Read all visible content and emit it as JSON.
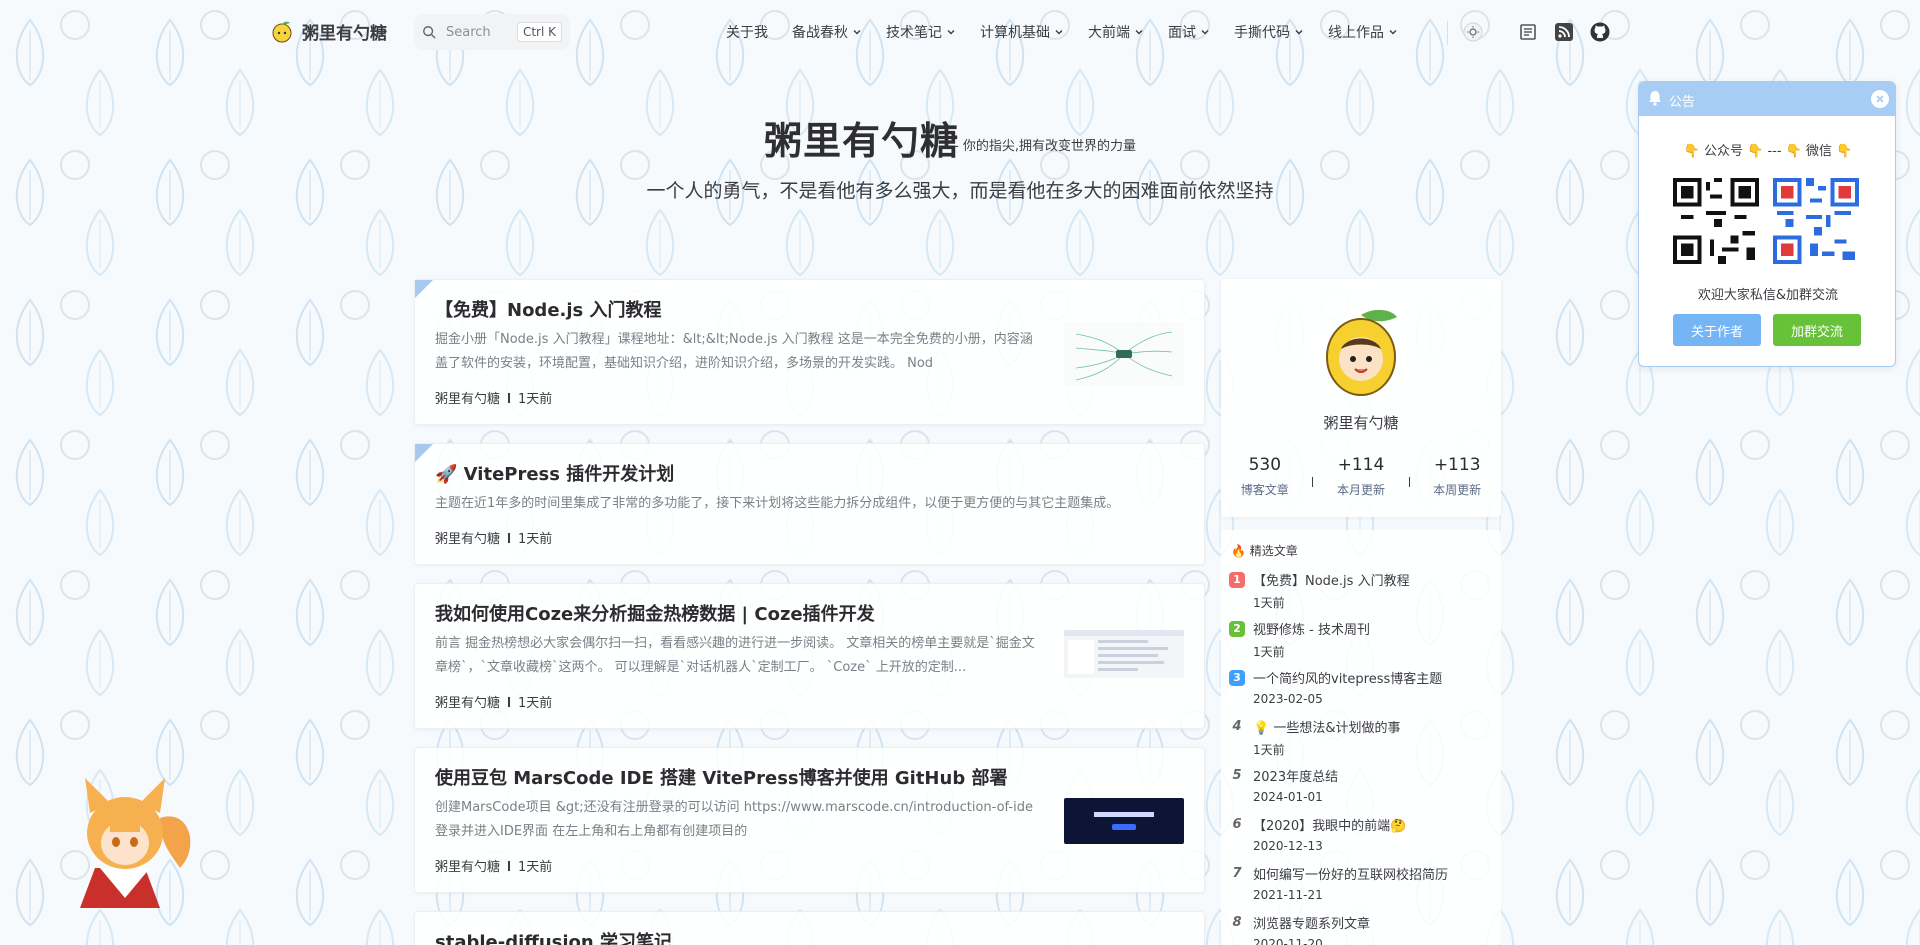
{
  "site": {
    "logo_text": "粥里有勺糖"
  },
  "search": {
    "placeholder": "Search",
    "shortcut": "Ctrl K"
  },
  "nav": {
    "items": [
      {
        "label": "关于我",
        "dropdown": false
      },
      {
        "label": "备战春秋",
        "dropdown": true
      },
      {
        "label": "技术笔记",
        "dropdown": true
      },
      {
        "label": "计算机基础",
        "dropdown": true
      },
      {
        "label": "大前端",
        "dropdown": true
      },
      {
        "label": "面试",
        "dropdown": true
      },
      {
        "label": "手撕代码",
        "dropdown": true
      },
      {
        "label": "线上作品",
        "dropdown": true
      }
    ]
  },
  "hero": {
    "title": "粥里有勺糖",
    "motto": "- 你的指尖,拥有改变世界的力量",
    "subtitle": "一个人的勇气，不是看他有多么强大，而是看他在多大的困难面前依然坚持"
  },
  "posts": [
    {
      "title": "【免费】Node.js 入门教程",
      "desc": "掘金小册「Node.js 入门教程」课程地址：&lt;&lt;Node.js 入门教程 这是一本完全免费的小册，内容涵盖了软件的安装，环境配置，基础知识介绍，进阶知识介绍，多场景的开发实践。 Nod",
      "author": "粥里有勺糖",
      "time": "1天前"
    },
    {
      "title": "🚀 VitePress 插件开发计划",
      "desc": "主题在近1年多的时间里集成了非常的多功能了，接下来计划将这些能力拆分成组件，以便于更方便的与其它主题集成。",
      "author": "粥里有勺糖",
      "time": "1天前"
    },
    {
      "title": "我如何使用Coze来分析掘金热榜数据 | Coze插件开发",
      "desc": "前言 掘金热榜想必大家会偶尔扫一扫，看看感兴趣的进行进一步阅读。 文章相关的榜单主要就是`掘金文章榜`，`文章收藏榜`这两个。 可以理解是`对话机器人`定制工厂。 `Coze` 上开放的定制...",
      "author": "粥里有勺糖",
      "time": "1天前"
    },
    {
      "title": "使用豆包 MarsCode IDE 搭建 VitePress博客并使用 GitHub 部署",
      "desc": "创建MarsCode项目 &gt;还没有注册登录的可以访问 https://www.marscode.cn/introduction-of-ide 登录并进入IDE界面 在左上角和右上角都有创建项目的",
      "author": "粥里有勺糖",
      "time": "1天前"
    },
    {
      "title": "stable-diffusion 学习笔记"
    }
  ],
  "profile": {
    "name": "粥里有勺糖",
    "stats": [
      {
        "value": "530",
        "label": "博客文章"
      },
      {
        "value": "+114",
        "label": "本月更新"
      },
      {
        "value": "+113",
        "label": "本周更新"
      }
    ]
  },
  "featured": {
    "heading": "🔥 精选文章",
    "items": [
      {
        "rank": "1",
        "title": "【免费】Node.js 入门教程",
        "date": "1天前",
        "color": "#f56c6c"
      },
      {
        "rank": "2",
        "title": "视野修炼 - 技术周刊",
        "date": "1天前",
        "color": "#67c23a"
      },
      {
        "rank": "3",
        "title": "一个简约风的vitepress博客主题",
        "date": "2023-02-05",
        "color": "#409eff"
      },
      {
        "rank": "4",
        "title": "💡 一些想法&计划做的事",
        "date": "1天前",
        "color": ""
      },
      {
        "rank": "5",
        "title": "2023年度总结",
        "date": "2024-01-01",
        "color": ""
      },
      {
        "rank": "6",
        "title": "【2020】我眼中的前端🤔",
        "date": "2020-12-13",
        "color": ""
      },
      {
        "rank": "7",
        "title": "如何编写一份好的互联网校招简历",
        "date": "2021-11-21",
        "color": ""
      },
      {
        "rank": "8",
        "title": "浏览器专题系列文章",
        "date": "2020-11-20",
        "color": ""
      }
    ]
  },
  "announcement": {
    "title": "公告",
    "line1": "👇 公众号 👇 --- 👇 微信 👇",
    "line2": "欢迎大家私信&加群交流",
    "btn_about": "关于作者",
    "btn_group": "加群交流",
    "about_color": "#75b5f5",
    "group_color": "#67c23a"
  }
}
